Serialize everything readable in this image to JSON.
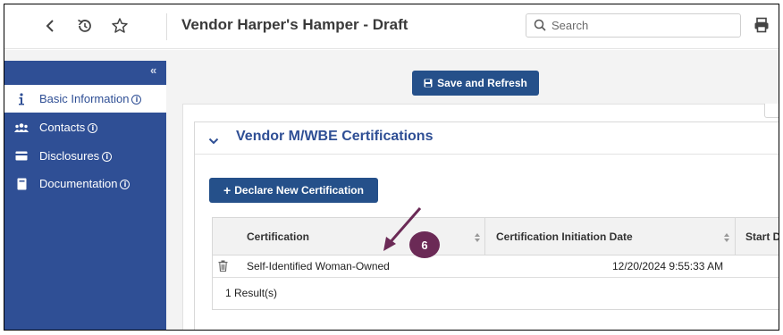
{
  "header": {
    "title": "Vendor Harper's Hamper - Draft",
    "search_placeholder": "Search"
  },
  "sidebar": {
    "collapse_glyph": "«",
    "items": [
      {
        "label": "Basic Information",
        "icon": "info-icon",
        "active": true
      },
      {
        "label": "Contacts",
        "icon": "users-icon",
        "active": false
      },
      {
        "label": "Disclosures",
        "icon": "card-icon",
        "active": false
      },
      {
        "label": "Documentation",
        "icon": "book-icon",
        "active": false
      }
    ]
  },
  "main": {
    "save_label": "Save and Refresh",
    "section_title": "Vendor M/WBE Certifications",
    "declare_label": "Declare New Certification",
    "table": {
      "columns": [
        "Certification",
        "Certification Initiation Date",
        "Start D"
      ],
      "rows": [
        {
          "certification": "Self-Identified Woman-Owned",
          "initiation_date": "12/20/2024 9:55:33 AM"
        }
      ],
      "result_count": "1 Result(s)"
    }
  },
  "annotation": {
    "badge_number": "6",
    "color": "#6b2a56"
  },
  "colors": {
    "sidebar": "#2f4f95",
    "button": "#25508a",
    "title": "#2f4f95"
  }
}
